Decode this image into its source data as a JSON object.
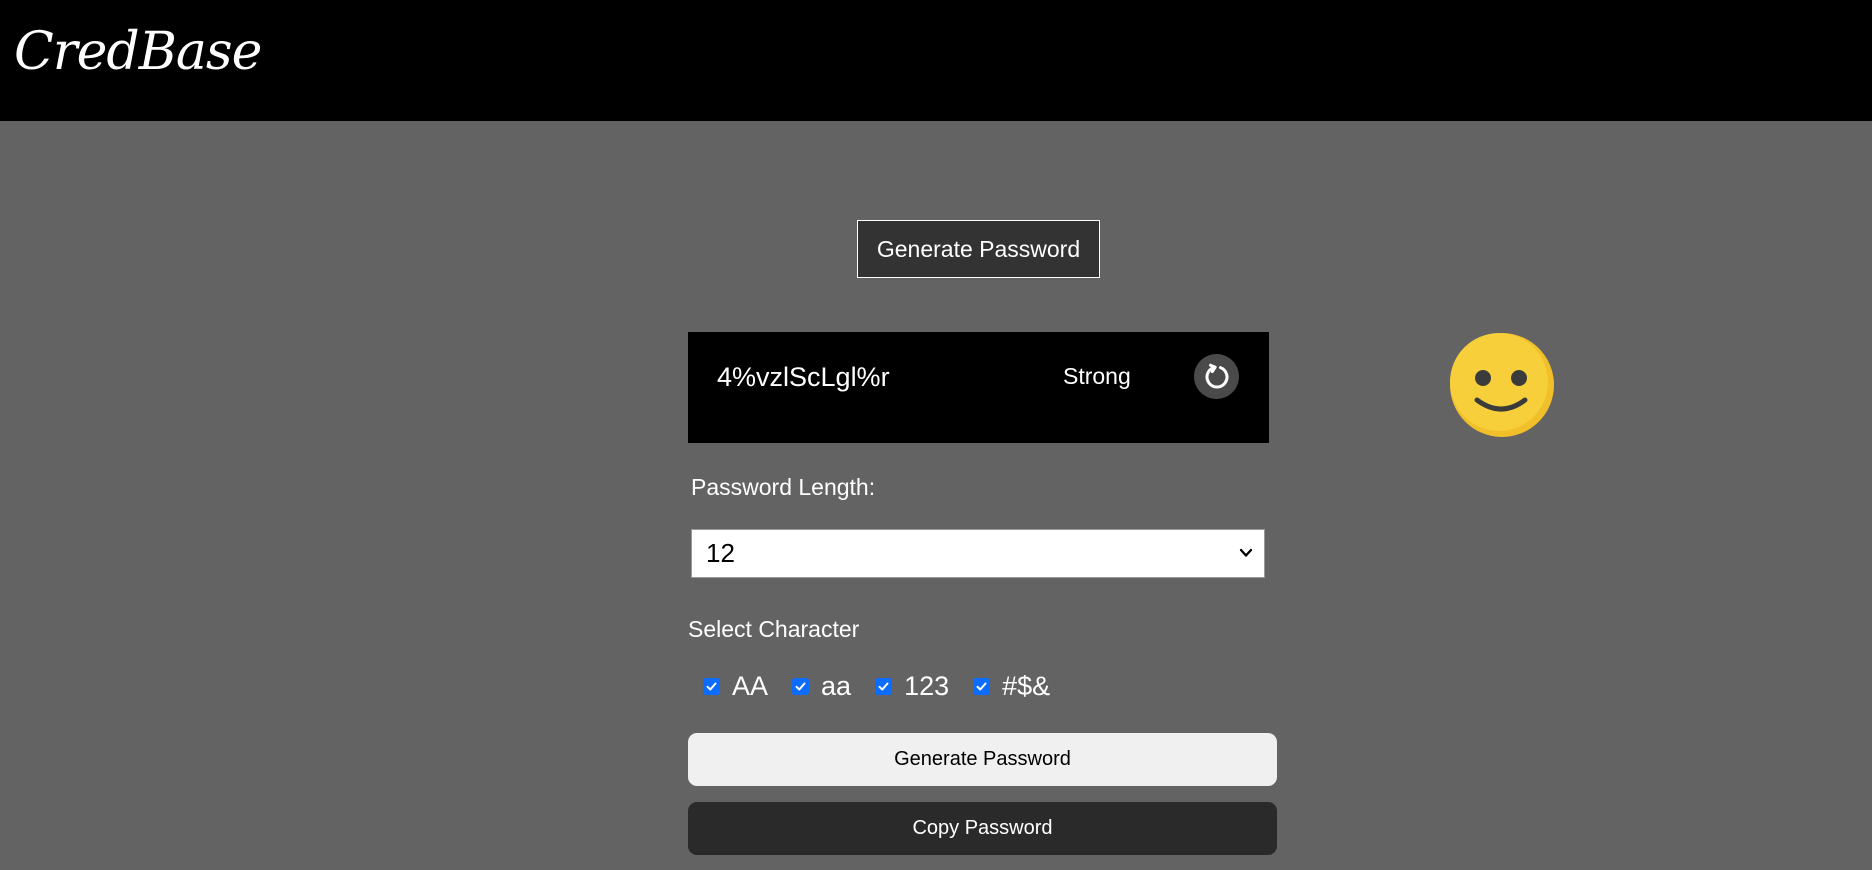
{
  "header": {
    "logo_text": "CredBase"
  },
  "main": {
    "title_button_label": "Generate Password",
    "result": {
      "password": "4%vzlScLgl%r",
      "strength": "Strong",
      "strength_face": "smiling"
    },
    "length": {
      "label": "Password Length:",
      "selected_value": "12"
    },
    "characters": {
      "label": "Select Character",
      "options": [
        {
          "label": "AA",
          "checked": true
        },
        {
          "label": "aa",
          "checked": true
        },
        {
          "label": "123",
          "checked": true
        },
        {
          "label": "#$&",
          "checked": true
        }
      ]
    },
    "generate_button_label": "Generate Password",
    "copy_button_label": "Copy Password"
  },
  "colors": {
    "header_bg": "#000000",
    "page_bg": "#636363",
    "checkbox": "#0b6cff",
    "smiley": "#f7cf3b"
  },
  "icons": {
    "refresh": "refresh-icon",
    "smiley": "smiley-face-icon",
    "chevron": "chevron-down-icon",
    "checkbox": "checkmark-icon"
  }
}
